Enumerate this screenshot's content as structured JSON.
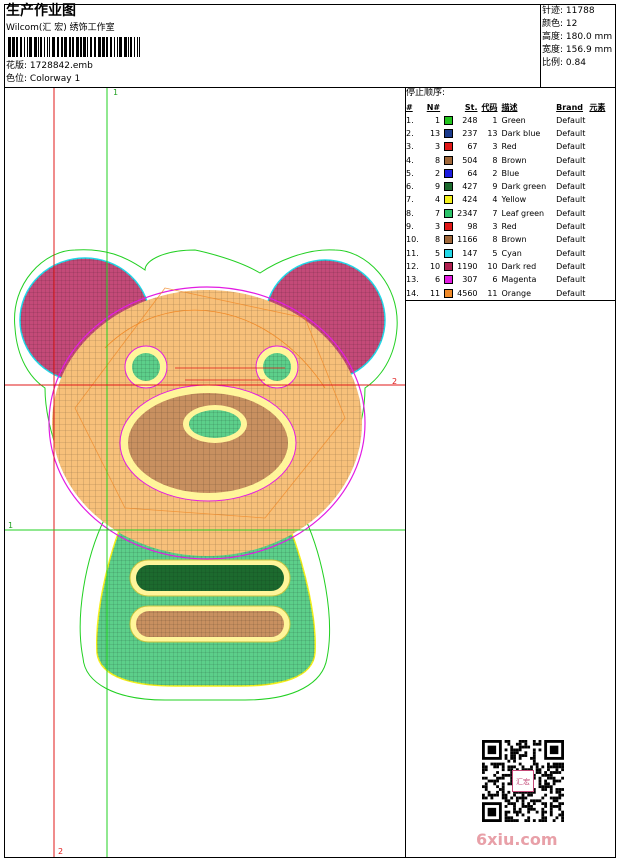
{
  "header": {
    "title": "生产作业图",
    "studio": "Wilcom(汇 宏) 绣饰工作室",
    "pattern_label": "花版:",
    "pattern_value": "1728842.emb",
    "colorway_label": "色位:",
    "colorway_value": "Colorway 1"
  },
  "stats": [
    {
      "label": "针迹:",
      "value": "11788"
    },
    {
      "label": "颜色:",
      "value": "12"
    },
    {
      "label": "高度:",
      "value": "180.0 mm"
    },
    {
      "label": "宽度:",
      "value": "156.9 mm"
    },
    {
      "label": "比例:",
      "value": "0.84"
    }
  ],
  "stop_sequence": {
    "title": "停止顺序:",
    "headers": [
      "#",
      "N#",
      "St.",
      "代码",
      "描述",
      "Brand",
      "元素"
    ],
    "rows": [
      {
        "idx": "1.",
        "n": "1",
        "color": "#22c41e",
        "st": "248",
        "code": "1",
        "desc": "Green",
        "brand": "Default"
      },
      {
        "idx": "2.",
        "n": "13",
        "color": "#1a3a8c",
        "st": "237",
        "code": "13",
        "desc": "Dark blue",
        "brand": "Default"
      },
      {
        "idx": "3.",
        "n": "3",
        "color": "#e01818",
        "st": "67",
        "code": "3",
        "desc": "Red",
        "brand": "Default"
      },
      {
        "idx": "4.",
        "n": "8",
        "color": "#a0683a",
        "st": "504",
        "code": "8",
        "desc": "Brown",
        "brand": "Default"
      },
      {
        "idx": "5.",
        "n": "2",
        "color": "#1c1ce0",
        "st": "64",
        "code": "2",
        "desc": "Blue",
        "brand": "Default"
      },
      {
        "idx": "6.",
        "n": "9",
        "color": "#1c6a2e",
        "st": "427",
        "code": "9",
        "desc": "Dark green",
        "brand": "Default"
      },
      {
        "idx": "7.",
        "n": "4",
        "color": "#f4f01c",
        "st": "424",
        "code": "4",
        "desc": "Yellow",
        "brand": "Default"
      },
      {
        "idx": "8.",
        "n": "7",
        "color": "#2cc46a",
        "st": "2347",
        "code": "7",
        "desc": "Leaf green",
        "brand": "Default"
      },
      {
        "idx": "9.",
        "n": "3",
        "color": "#e01818",
        "st": "98",
        "code": "3",
        "desc": "Red",
        "brand": "Default"
      },
      {
        "idx": "10.",
        "n": "8",
        "color": "#a0683a",
        "st": "1166",
        "code": "8",
        "desc": "Brown",
        "brand": "Default"
      },
      {
        "idx": "11.",
        "n": "5",
        "color": "#22d8e8",
        "st": "147",
        "code": "5",
        "desc": "Cyan",
        "brand": "Default"
      },
      {
        "idx": "12.",
        "n": "10",
        "color": "#b02050",
        "st": "1190",
        "code": "10",
        "desc": "Dark red",
        "brand": "Default"
      },
      {
        "idx": "13.",
        "n": "6",
        "color": "#e21ce2",
        "st": "307",
        "code": "6",
        "desc": "Magenta",
        "brand": "Default"
      },
      {
        "idx": "14.",
        "n": "11",
        "color": "#f08a28",
        "st": "4560",
        "code": "11",
        "desc": "Orange",
        "brand": "Default"
      }
    ]
  },
  "guides": {
    "v1_label": "1",
    "v2_label": "2",
    "h1_label": "1",
    "h2_label": "2"
  },
  "watermark": "6xiu.com",
  "qr_center_text": "汇宏"
}
